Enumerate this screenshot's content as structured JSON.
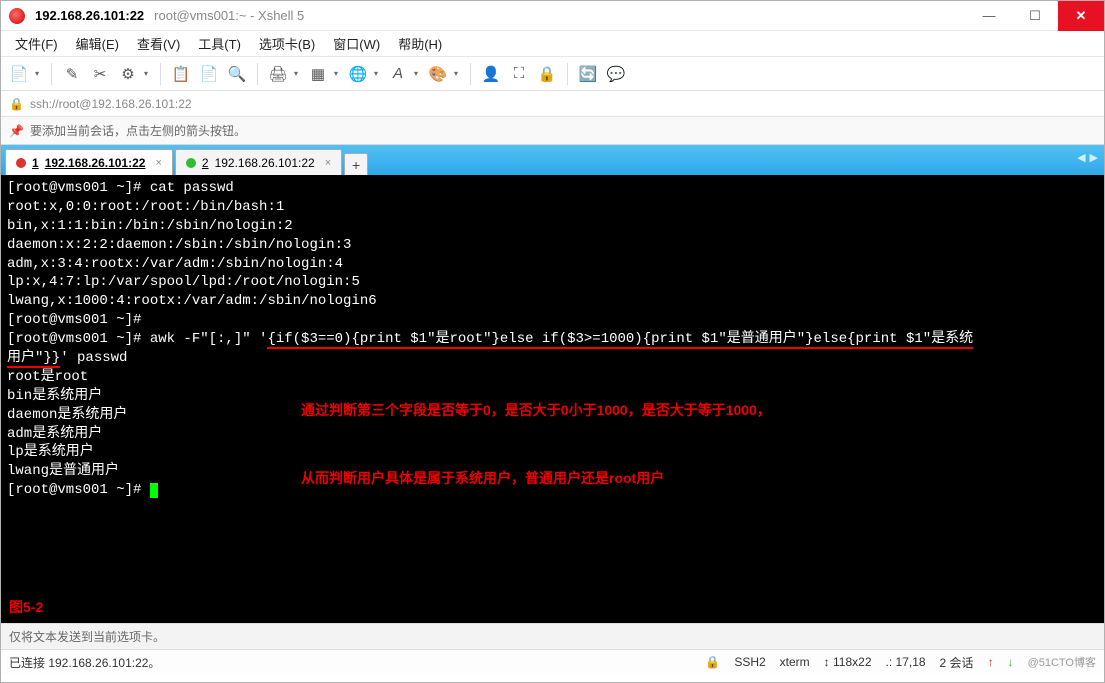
{
  "title": {
    "main": "192.168.26.101:22",
    "sub": "root@vms001:~ - Xshell 5"
  },
  "menu": [
    "文件(F)",
    "编辑(E)",
    "查看(V)",
    "工具(T)",
    "选项卡(B)",
    "窗口(W)",
    "帮助(H)"
  ],
  "address": "ssh://root@192.168.26.101:22",
  "hint": "要添加当前会话，点击左侧的箭头按钮。",
  "tabs": [
    {
      "index": "1",
      "label": "192.168.26.101:22",
      "status": "red",
      "active": true
    },
    {
      "index": "2",
      "label": "192.168.26.101:22",
      "status": "green",
      "active": false
    }
  ],
  "terminal": {
    "lines_before": "[root@vms001 ~]# cat passwd\nroot:x,0:0:root:/root:/bin/bash:1\nbin,x:1:1:bin:/bin:/sbin/nologin:2\ndaemon:x:2:2:daemon:/sbin:/sbin/nologin:3\nadm,x:3:4:rootx:/var/adm:/sbin/nologin:4\nlp:x,4:7:lp:/var/spool/lpd:/root/nologin:5\nlwang,x:1000:4:rootx:/var/adm:/sbin/nologin6\n[root@vms001 ~]#",
    "cmd_prefix": "[root@vms001 ~]# awk -F\"[:,]\" '",
    "cmd_script": "{if($3==0){print $1\"是root\"}else if($3>=1000){print $1\"是普通用户\"}else{print $1\"是系统",
    "cmd_wrap": "用户\"}}",
    "cmd_suffix": "' passwd",
    "lines_after": "root是root\nbin是系统用户\ndaemon是系统用户\nadm是系统用户\nlp是系统用户\nlwang是普通用户",
    "prompt_final": "[root@vms001 ~]# ",
    "annotation_line1": "通过判断第三个字段是否等于0，是否大于0小于1000，是否大于等于1000，",
    "annotation_line2": "从而判断用户具体是属于系统用户，普通用户还是root用户",
    "figure_label": "图5-2"
  },
  "bottom_info": "仅将文本发送到当前选项卡。",
  "status": {
    "connected": "已连接 192.168.26.101:22。",
    "proto": "SSH2",
    "term": "xterm",
    "size": "118x22",
    "pos": "17,18",
    "sessions": "2 会话",
    "watermark": "@51CTO博客"
  },
  "icons": {
    "lock": "🔒",
    "pin": "📌",
    "minimize": "—",
    "maximize": "☐",
    "close": "✕",
    "plus": "+",
    "left": "◀",
    "right": "▶",
    "dim": "↕"
  }
}
